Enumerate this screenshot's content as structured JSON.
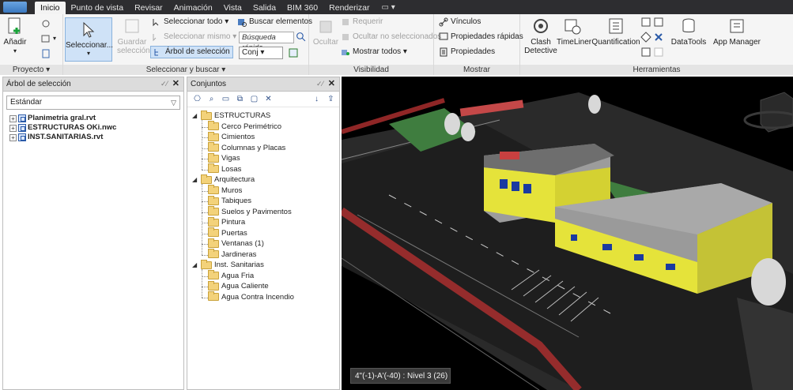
{
  "tabs": [
    {
      "label": "Inicio",
      "active": true
    },
    {
      "label": "Punto de vista"
    },
    {
      "label": "Revisar"
    },
    {
      "label": "Animación"
    },
    {
      "label": "Vista"
    },
    {
      "label": "Salida"
    },
    {
      "label": "BIM 360"
    },
    {
      "label": "Renderizar"
    }
  ],
  "ribbon": {
    "proyecto": {
      "title": "Proyecto ▾",
      "add_label": "Añadir"
    },
    "seleccionar": {
      "title": "Seleccionar y buscar ▾",
      "select_label": "Seleccionar...",
      "save_label": "Guardar selección",
      "select_all": "Seleccionar todo ▾",
      "select_same": "Seleccionar mismo ▾",
      "selection_tree": "Árbol de selección",
      "find_items": "Buscar elementos",
      "quick_find_placeholder": "Búsqueda rápida",
      "sets_combo": "Conj ▾"
    },
    "visibilidad": {
      "title": "Visibilidad",
      "hide": "Ocultar",
      "require": "Requerir",
      "hide_unselected": "Ocultar no seleccionados",
      "show_all": "Mostrar todos ▾"
    },
    "mostrar": {
      "title": "Mostrar",
      "links": "Vínculos",
      "quick_properties": "Propiedades rápidas",
      "properties": "Propiedades"
    },
    "herramientas": {
      "title": "Herramientas",
      "clash": "Clash Detective",
      "timeliner": "TimeLiner",
      "quantification": "Quantification",
      "datatools": "DataTools",
      "appmanager": "App Manager"
    }
  },
  "selection_tree": {
    "title": "Árbol de selección",
    "dropdown_value": "Estándar",
    "items": [
      "Planimetria gral.rvt",
      "ESTRUCTURAS OKi.nwc",
      "INST.SANITARIAS.rvt"
    ]
  },
  "sets": {
    "title": "Conjuntos",
    "nodes": [
      {
        "label": "ESTRUCTURAS",
        "level": 0
      },
      {
        "label": "Cerco Perimétrico",
        "level": 1
      },
      {
        "label": "Cimientos",
        "level": 1
      },
      {
        "label": "Columnas y Placas",
        "level": 1
      },
      {
        "label": "Vigas",
        "level": 1
      },
      {
        "label": "Losas",
        "level": 1
      },
      {
        "label": "Arquitectura",
        "level": 0
      },
      {
        "label": "Muros",
        "level": 1
      },
      {
        "label": "Tabiques",
        "level": 1
      },
      {
        "label": "Suelos y Pavimentos",
        "level": 1
      },
      {
        "label": "Pintura",
        "level": 1
      },
      {
        "label": "Puertas",
        "level": 1
      },
      {
        "label": "Ventanas (1)",
        "level": 1
      },
      {
        "label": "Jardineras",
        "level": 1
      },
      {
        "label": "Inst. Sanitarias",
        "level": 0
      },
      {
        "label": "Agua Fria",
        "level": 1
      },
      {
        "label": "Agua Caliente",
        "level": 1
      },
      {
        "label": "Agua Contra Incendio",
        "level": 1
      }
    ]
  },
  "viewport": {
    "status_text": "4\"(-1)-A'(-40) : Nivel 3 (26)"
  }
}
